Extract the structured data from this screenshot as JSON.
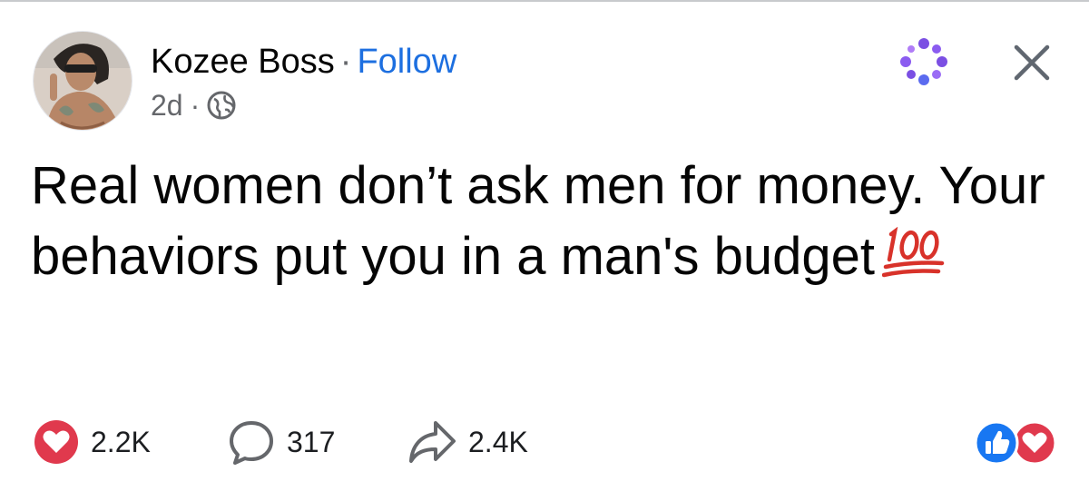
{
  "post": {
    "author": "Kozee Boss",
    "separator": "·",
    "follow_label": "Follow",
    "time": "2d",
    "time_separator": "·",
    "audience_icon": "globe-icon",
    "text": "Real women don’t ask men for money. Your behaviors put you in a man's budget",
    "emoji_icon": "hundred-points-icon"
  },
  "header_actions": {
    "more_icon": "ai-sparkle-icon",
    "close_icon": "close-icon"
  },
  "stats": {
    "likes": "2.2K",
    "comments": "317",
    "shares": "2.4K"
  },
  "reaction_badges": [
    "like-icon",
    "love-icon"
  ],
  "colors": {
    "follow": "#1d6fe0",
    "love": "#e0394d",
    "like": "#1877f2",
    "muted_text": "#65676b",
    "sparkle": "#7b4fe3"
  }
}
